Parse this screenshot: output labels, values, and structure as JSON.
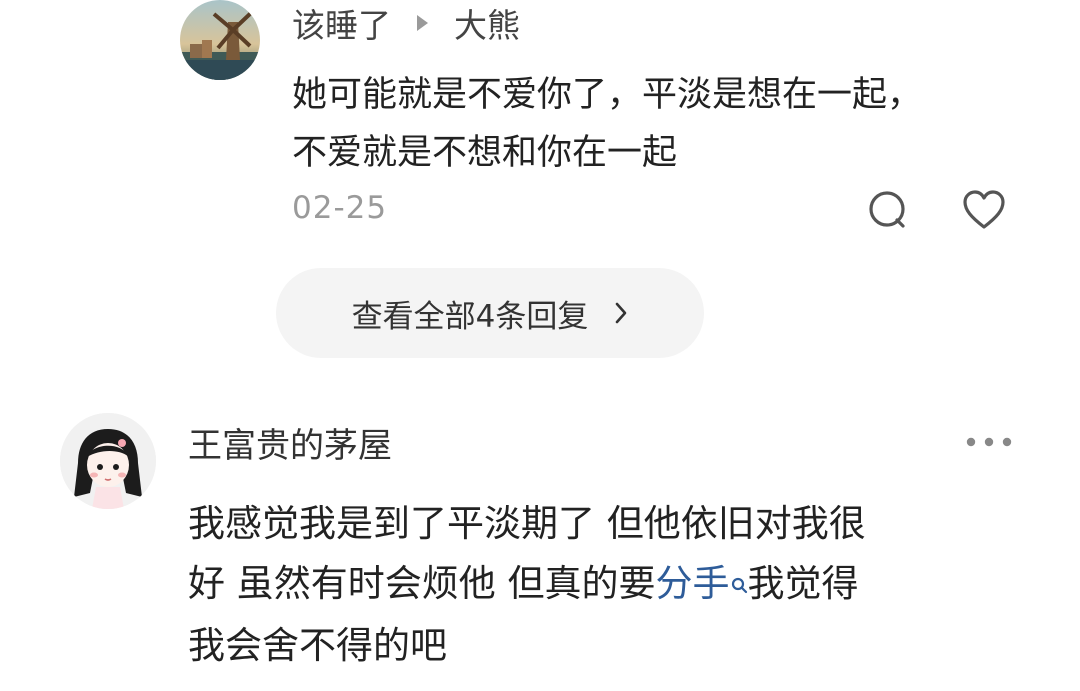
{
  "reply": {
    "author": "该睡了",
    "reply_to": "大熊",
    "text_line1": "她可能就是不爱你了，平淡是想在一起，",
    "text_line2": "不爱就是不想和你在一起",
    "time": "02-25",
    "icons": {
      "comment": "comment-bubble-icon",
      "like": "heart-icon",
      "arrow": "play-triangle-icon"
    }
  },
  "view_all": {
    "label": "查看全部4条回复",
    "icon": "chevron-right-icon"
  },
  "comment": {
    "author": "王富贵的茅屋",
    "text_line1": "我感觉我是到了平淡期了 但他依旧对我很",
    "text_line2_before": "好 虽然有时会烦他 但真的要",
    "text_link": "分手",
    "text_line2_after": "我觉得",
    "text_line3": "我会舍不得的吧",
    "icons": {
      "more": "more-dots-icon",
      "link_search": "search-icon"
    }
  },
  "colors": {
    "link": "#2e5c99",
    "muted": "#9a9a9a",
    "pill_bg": "#f4f4f4",
    "text": "#222222"
  }
}
